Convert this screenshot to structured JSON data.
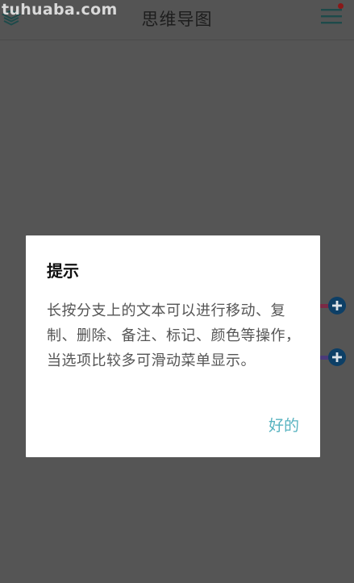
{
  "watermark": "tuhuaba.com",
  "header": {
    "title": "思维导图",
    "left_icon": "layers-icon",
    "right_icon": "menu-icon",
    "notification_color": "#8a1818"
  },
  "dialog": {
    "title": "提示",
    "message": "长按分支上的文本可以进行移动、复制、删除、备注、标记、颜色等操作，当选项比较多可滑动菜单显示。",
    "ok_label": "好的",
    "ok_color": "#58b3c0"
  },
  "mindmap": {
    "add_node_icon": "plus-circle-icon",
    "branch_colors": [
      "#7a2a45",
      "#4b3a78"
    ]
  }
}
